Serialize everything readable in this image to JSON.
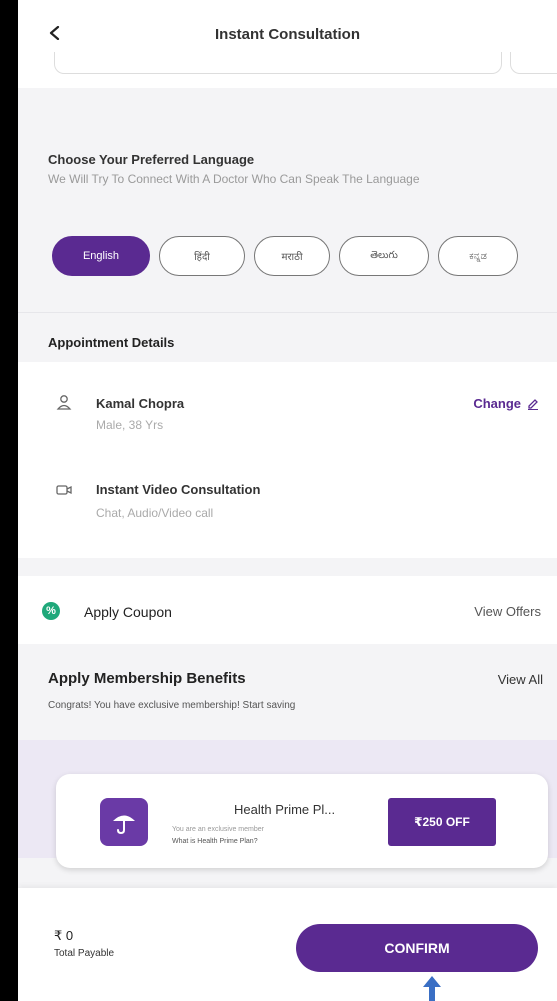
{
  "header": {
    "title": "Instant Consultation"
  },
  "language": {
    "title": "Choose Your Preferred Language",
    "subtitle": "We Will Try To Connect With A Doctor Who Can Speak The Language",
    "options": [
      {
        "label": "English",
        "active": true
      },
      {
        "label": "हिंदी",
        "active": false
      },
      {
        "label": "मराठी",
        "active": false
      },
      {
        "label": "తెలుగు",
        "active": false
      },
      {
        "label": "ಕನ್ನಡ",
        "active": false
      }
    ]
  },
  "appointment": {
    "heading": "Appointment Details",
    "patient_name": "Kamal Chopra",
    "patient_meta": "Male, 38 Yrs",
    "change_label": "Change",
    "consult_title": "Instant Video Consultation",
    "consult_meta": "Chat, Audio/Video call"
  },
  "coupon": {
    "label": "Apply Coupon",
    "link": "View Offers"
  },
  "membership": {
    "title": "Apply Membership Benefits",
    "view_all": "View All",
    "subtitle": "Congrats! You have exclusive membership! Start saving",
    "plan_name": "Health Prime Pl...",
    "plan_line1": "You are an exclusive member",
    "plan_line2": "What is Health Prime Plan?",
    "off_label": "₹250 OFF"
  },
  "footer": {
    "amount": "₹ 0",
    "amount_label": "Total Payable",
    "confirm_label": "CONFIRM"
  },
  "colors": {
    "brand": "#5a2a91",
    "coupon": "#1fa87a",
    "pointer": "#3a6fc4"
  }
}
